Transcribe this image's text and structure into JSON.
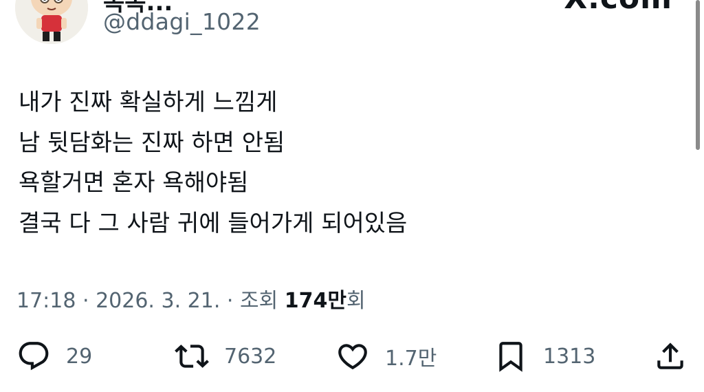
{
  "header": {
    "display_name": "똑똑...",
    "handle": "@ddagi_1022",
    "logo_text": "X.com"
  },
  "tweet": {
    "lines": [
      "내가 진짜 확실하게 느낌게",
      "남 뒷담화는 진짜 하면 안됨",
      "욕할거면 혼자 욕해야됨",
      "결국 다 그 사람 귀에 들어가게 되어있음"
    ]
  },
  "meta": {
    "time": "17:18",
    "separator": " · ",
    "date": "2026. 3. 21.",
    "views_label_prefix": "조회 ",
    "views_count": "174만",
    "views_label_suffix": "회"
  },
  "actions": {
    "replies": "29",
    "retweets": "7632",
    "likes": "1.7만",
    "bookmarks": "1313"
  },
  "colors": {
    "text": "#0f1419",
    "secondary": "#536471",
    "background": "#ffffff"
  },
  "icons": [
    "reply-icon",
    "retweet-icon",
    "like-icon",
    "bookmark-icon",
    "share-icon"
  ]
}
